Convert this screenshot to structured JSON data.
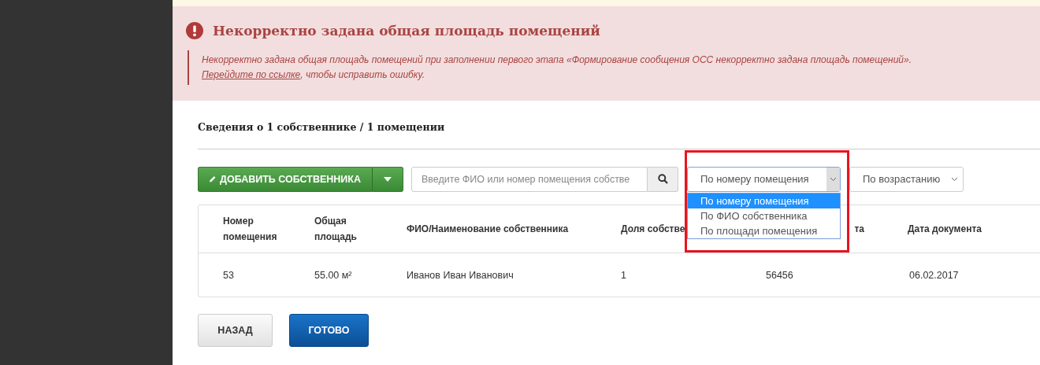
{
  "alert": {
    "title": "Некорректно задана общая площадь помещений",
    "message": "Некорректно задана общая площадь помещений при заполнении первого этапа «Формирование сообщения ОСС некорректно задана площадь помещений».",
    "link": "Перейдите по ссылке",
    "after_link": ", чтобы исправить ошибку."
  },
  "summary": "Сведения о 1 собственнике / 1 помещении",
  "toolbar": {
    "add_button": "ДОБАВИТЬ СОБСТВЕННИКА",
    "search": {
      "placeholder": "Введите ФИО или номер помещения собстве"
    },
    "sort_field": {
      "value": "По номеру помещения",
      "expanded": true,
      "options": [
        {
          "label": "По номеру помещения",
          "selected": true
        },
        {
          "label": "По ФИО собственника",
          "selected": false
        },
        {
          "label": "По площади помещения",
          "selected": false
        }
      ]
    },
    "sort_order": {
      "value": "По возрастанию"
    }
  },
  "table": {
    "columns": [
      {
        "lines": [
          "Номер",
          "помещения"
        ]
      },
      {
        "lines": [
          "Общая",
          "площадь"
        ]
      },
      {
        "lines": [
          "ФИО/Наименование собственника"
        ]
      },
      {
        "lines": [
          "Доля собстве"
        ]
      },
      {
        "lines": [
          "та"
        ]
      },
      {
        "lines": [
          "Дата документа"
        ]
      }
    ],
    "rows": [
      [
        "53",
        "55.00 м²",
        "Иванов Иван Иванович",
        "1",
        "56456",
        "06.02.2017"
      ]
    ]
  },
  "buttons": [
    {
      "label": "НАЗАД",
      "kind": "secondary"
    },
    {
      "label": "ГОТОВО",
      "kind": "primary"
    }
  ]
}
